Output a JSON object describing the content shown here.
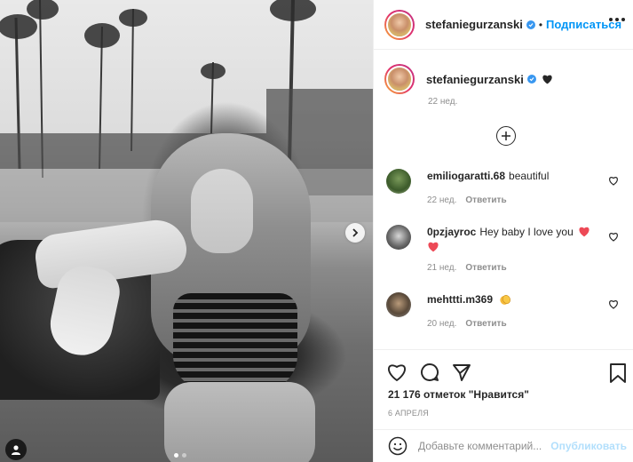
{
  "post": {
    "author": "stefaniegurzanski",
    "follow_label": "Подписаться",
    "header_separator": "•",
    "caption_time": "22 нед.",
    "likes_text": "21 176 отметок \"Нравится\"",
    "date_text": "6 АПРЕЛЯ",
    "carousel_dots": 2,
    "carousel_active": 0
  },
  "comments": [
    {
      "user": "emiliogaratti.68",
      "text": "beautiful",
      "time": "22 нед.",
      "reply": "Ответить"
    },
    {
      "user": "0pzjayroc",
      "text": "Hey baby I love you",
      "time": "21 нед.",
      "reply": "Ответить"
    },
    {
      "user": "mehttti.m369",
      "text": "",
      "time": "20 нед.",
      "reply": "Ответить"
    }
  ],
  "add_comment": {
    "placeholder": "Добавьте комментарий...",
    "publish_label": "Опубликовать"
  },
  "colors": {
    "accent": "#0095f6",
    "verified": "#3897f0",
    "heart_red": "#ed4956",
    "muted": "#8e8e8e",
    "publish_disabled": "#b2dffc"
  },
  "icons": {
    "more": "more-horizontal-icon",
    "verified": "verified-badge-icon",
    "caption_emoji": "black-heart-icon",
    "load_more": "plus-circle-icon",
    "comment_like": "heart-outline-icon",
    "emoji_red_heart": "red-heart-icon",
    "emoji_clap": "clapping-hands-icon",
    "like": "heart-outline-icon",
    "comment": "comment-icon",
    "share": "paper-plane-icon",
    "save": "bookmark-icon",
    "emoji_picker": "smiley-icon",
    "next": "chevron-right-icon",
    "user_tag": "user-tag-icon"
  }
}
